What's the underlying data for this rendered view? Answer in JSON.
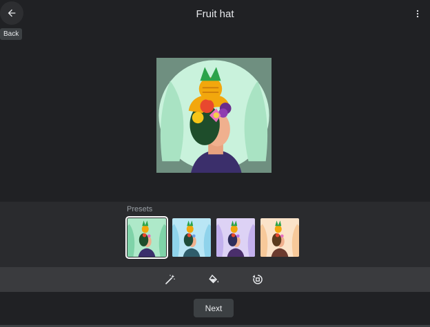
{
  "header": {
    "title": "Fruit hat",
    "back_tooltip": "Back",
    "back_icon": "arrow-back-icon",
    "menu_icon": "more-vert-icon"
  },
  "presets": {
    "label": "Presets",
    "items": [
      {
        "name": "mint",
        "bg": "#aee9c9",
        "accent": "#7fd3a8",
        "selected": true
      },
      {
        "name": "sky",
        "bg": "#b9e6f5",
        "accent": "#8fd3eb",
        "selected": false
      },
      {
        "name": "lavender",
        "bg": "#ddd2f5",
        "accent": "#c3b1ee",
        "selected": false
      },
      {
        "name": "peach",
        "bg": "#fbe3c9",
        "accent": "#f7c99a",
        "selected": false
      }
    ]
  },
  "tools": [
    "magic-wand-icon",
    "paint-bucket-icon",
    "rotate-icon"
  ],
  "actions": {
    "next_label": "Next"
  },
  "colors": {
    "background": "#202124",
    "panel": "#2a2b2e",
    "toolbar": "#3a3b3e"
  }
}
